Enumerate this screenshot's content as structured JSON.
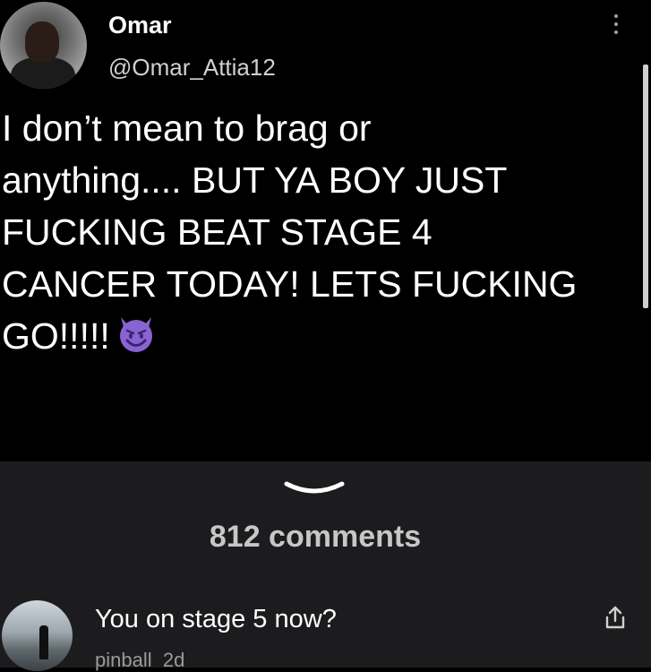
{
  "tweet": {
    "author_name": "Omar",
    "author_handle": "@Omar_Attia12",
    "text_lines": [
      "I don’t mean to brag or",
      "anything.... BUT YA BOY JUST",
      "FUCKING BEAT STAGE 4",
      "CANCER TODAY! LETS FUCKING",
      "GO!!!!!"
    ],
    "emoji": "smiling-devil-emoji"
  },
  "comments": {
    "count_label": "812 comments",
    "items": [
      {
        "text": "You on stage 5 now?",
        "author": "pinball",
        "age": "2d"
      }
    ]
  },
  "colors": {
    "background": "#000000",
    "panel": "#1c1c1e",
    "emoji_purple": "#8a63d2"
  }
}
